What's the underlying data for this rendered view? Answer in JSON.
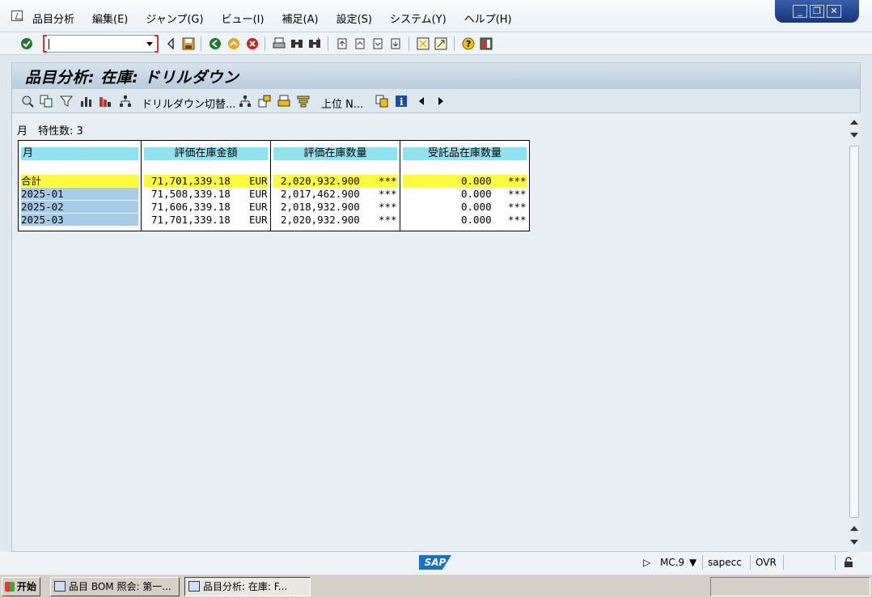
{
  "menu": {
    "items": [
      "品目分析",
      "編集(E)",
      "ジャンプ(G)",
      "ビュー(I)",
      "補足(A)",
      "設定(S)",
      "システム(Y)",
      "ヘルプ(H)"
    ]
  },
  "screen": {
    "title": "品目分析: 在庫: ドリルダウン"
  },
  "app_toolbar": {
    "drilldown_switch": "ドリルダウン切替...",
    "top_n": "上位 N..."
  },
  "info": {
    "label": "月　特性数: 3"
  },
  "table": {
    "columns": [
      "月",
      "評価在庫金額",
      "評価在庫数量",
      "受託品在庫数量"
    ],
    "rows": [
      {
        "month": "合計",
        "value": "71,701,339.18",
        "value_unit": "EUR",
        "qty": "2,020,932.900",
        "qty_unit": "***",
        "consign": "0.000",
        "consign_unit": "***"
      },
      {
        "month": "2025-01",
        "value": "71,508,339.18",
        "value_unit": "EUR",
        "qty": "2,017,462.900",
        "qty_unit": "***",
        "consign": "0.000",
        "consign_unit": "***"
      },
      {
        "month": "2025-02",
        "value": "71,606,339.18",
        "value_unit": "EUR",
        "qty": "2,018,932.900",
        "qty_unit": "***",
        "consign": "0.000",
        "consign_unit": "***"
      },
      {
        "month": "2025-03",
        "value": "71,701,339.18",
        "value_unit": "EUR",
        "qty": "2,020,932.900",
        "qty_unit": "***",
        "consign": "0.000",
        "consign_unit": "***"
      }
    ]
  },
  "statusbar": {
    "logo": "SAP",
    "transaction": "MC.9",
    "server": "sapecc",
    "mode": "OVR"
  },
  "taskbar": {
    "start": "开始",
    "tasks": [
      "品目 BOM 照会: 第一...",
      "品目分析: 在庫: F..."
    ]
  },
  "colors": {
    "header_cyan": "#8fe3f0",
    "total_yellow": "#fffb3a",
    "key_blue": "#a8cbe7"
  }
}
